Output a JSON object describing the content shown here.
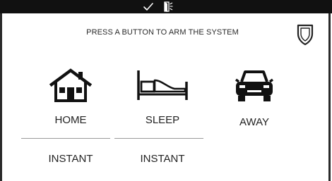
{
  "status_bar": {
    "icons": [
      "checkmark-icon",
      "door-open-icon"
    ]
  },
  "prompt": "PRESS A BUTTON TO ARM THE SYSTEM",
  "header_icon": "shield-icon",
  "modes": [
    {
      "label": "HOME",
      "icon": "house-icon",
      "delay": "INSTANT"
    },
    {
      "label": "SLEEP",
      "icon": "bed-icon",
      "delay": "INSTANT"
    },
    {
      "label": "AWAY",
      "icon": "car-icon"
    }
  ],
  "colors": {
    "status_bar": "#111111",
    "frame": "#2a2a2a",
    "text": "#222222",
    "divider": "#9a9a9a",
    "background": "#ffffff"
  }
}
